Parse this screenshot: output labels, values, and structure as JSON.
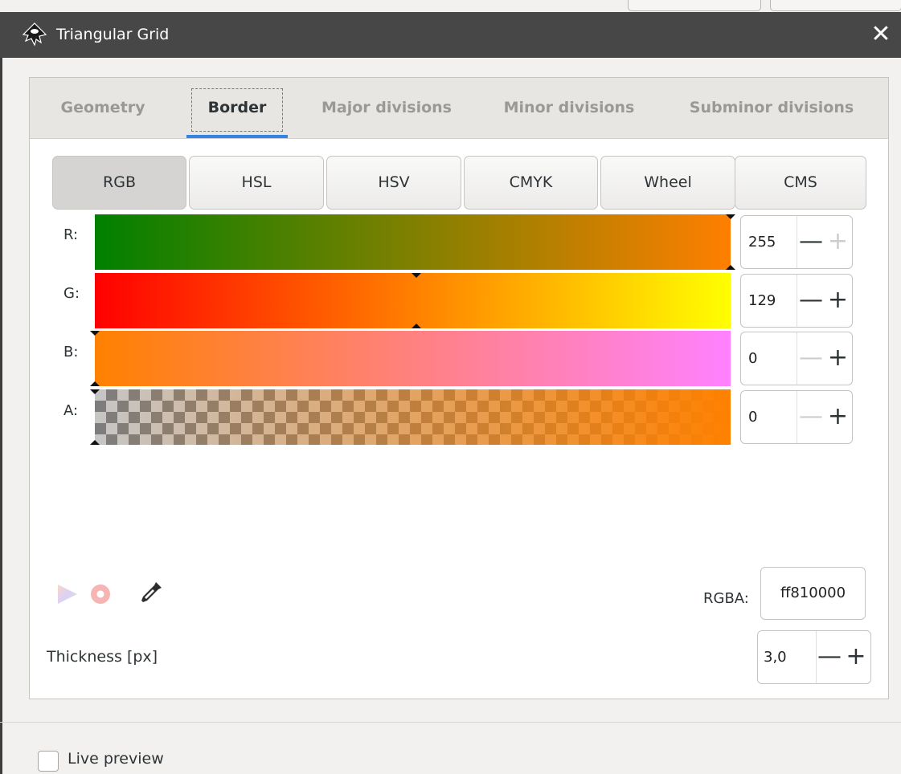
{
  "window": {
    "title": "Triangular Grid",
    "close_glyph": "✕",
    "icon": "inkscape-icon"
  },
  "tabs": [
    {
      "label": "Geometry",
      "active": false
    },
    {
      "label": "Border",
      "active": true
    },
    {
      "label": "Major divisions",
      "active": false
    },
    {
      "label": "Minor divisions",
      "active": false
    },
    {
      "label": "Subminor divisions",
      "active": false
    }
  ],
  "color_modes": [
    {
      "label": "RGB",
      "active": true
    },
    {
      "label": "HSL",
      "active": false
    },
    {
      "label": "HSV",
      "active": false
    },
    {
      "label": "CMYK",
      "active": false
    },
    {
      "label": "Wheel",
      "active": false
    },
    {
      "label": "CMS",
      "active": false
    }
  ],
  "channels": [
    {
      "label": "R:",
      "value": "255",
      "level": 1.0,
      "gradient_from": "#008000",
      "gradient_to": "#ff7f00",
      "minus_enabled": true,
      "plus_enabled": false
    },
    {
      "label": "G:",
      "value": "129",
      "level": 0.506,
      "gradient_from": "#ff0000",
      "gradient_to": "#ffff00",
      "minus_enabled": true,
      "plus_enabled": true
    },
    {
      "label": "B:",
      "value": "0",
      "level": 0.0,
      "gradient_from": "#ff8100",
      "gradient_to": "#ff81ff",
      "minus_enabled": false,
      "plus_enabled": true
    },
    {
      "label": "A:",
      "value": "0",
      "level": 0.0,
      "gradient_from": "transparent",
      "gradient_to": "#ff8100",
      "minus_enabled": false,
      "plus_enabled": true
    }
  ],
  "spin_glyphs": {
    "minus": "—",
    "plus": "+"
  },
  "tools": [
    "color-managed-icon",
    "out-of-gamut-icon",
    "eyedropper-icon"
  ],
  "rgba": {
    "label": "RGBA:",
    "value": "ff810000"
  },
  "thickness": {
    "label": "Thickness [px]",
    "value": "3,0"
  },
  "live_preview": {
    "label": "Live preview",
    "checked": false
  },
  "colors": {
    "accent": "#3584e4",
    "titlebar": "#474747",
    "current_color": "#ff8100"
  }
}
